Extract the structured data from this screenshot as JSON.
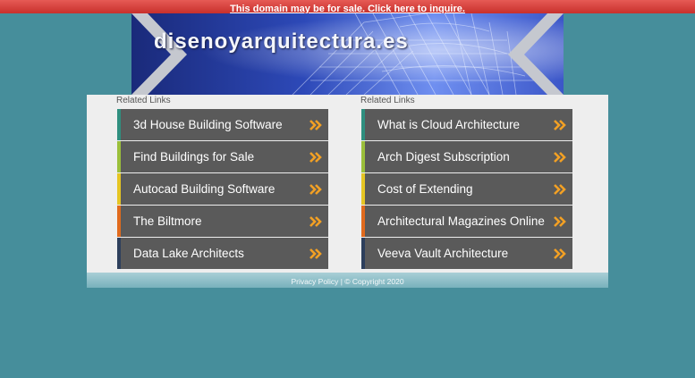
{
  "top_notice": {
    "text": "This domain may be for sale. Click here to inquire."
  },
  "header": {
    "site_title": "disenoyarquitectura.es"
  },
  "columns": [
    {
      "heading": "Related Links",
      "items": [
        {
          "label": "3d House Building Software",
          "accent": "#2f8f7f"
        },
        {
          "label": "Find Buildings for Sale",
          "accent": "#9bbf3b"
        },
        {
          "label": "Autocad Building Software",
          "accent": "#e5c523"
        },
        {
          "label": "The Biltmore",
          "accent": "#e06a1d"
        },
        {
          "label": "Data Lake Architects",
          "accent": "#2d3f5c"
        }
      ]
    },
    {
      "heading": "Related Links",
      "items": [
        {
          "label": "What is Cloud Architecture",
          "accent": "#2f8f7f"
        },
        {
          "label": "Arch Digest Subscription",
          "accent": "#9bbf3b"
        },
        {
          "label": "Cost of Extending",
          "accent": "#e5c523"
        },
        {
          "label": "Architectural Magazines Online",
          "accent": "#e06a1d"
        },
        {
          "label": "Veeva Vault Architecture",
          "accent": "#2d3f5c"
        }
      ]
    }
  ],
  "footer": {
    "text": "Privacy Policy | © Copyright 2020"
  },
  "colors": {
    "background": "#468e9b",
    "item_background": "#5a5a5a",
    "arrow": "#f2a024"
  },
  "icons": {
    "item_arrow": "double-chevron-right-icon"
  }
}
